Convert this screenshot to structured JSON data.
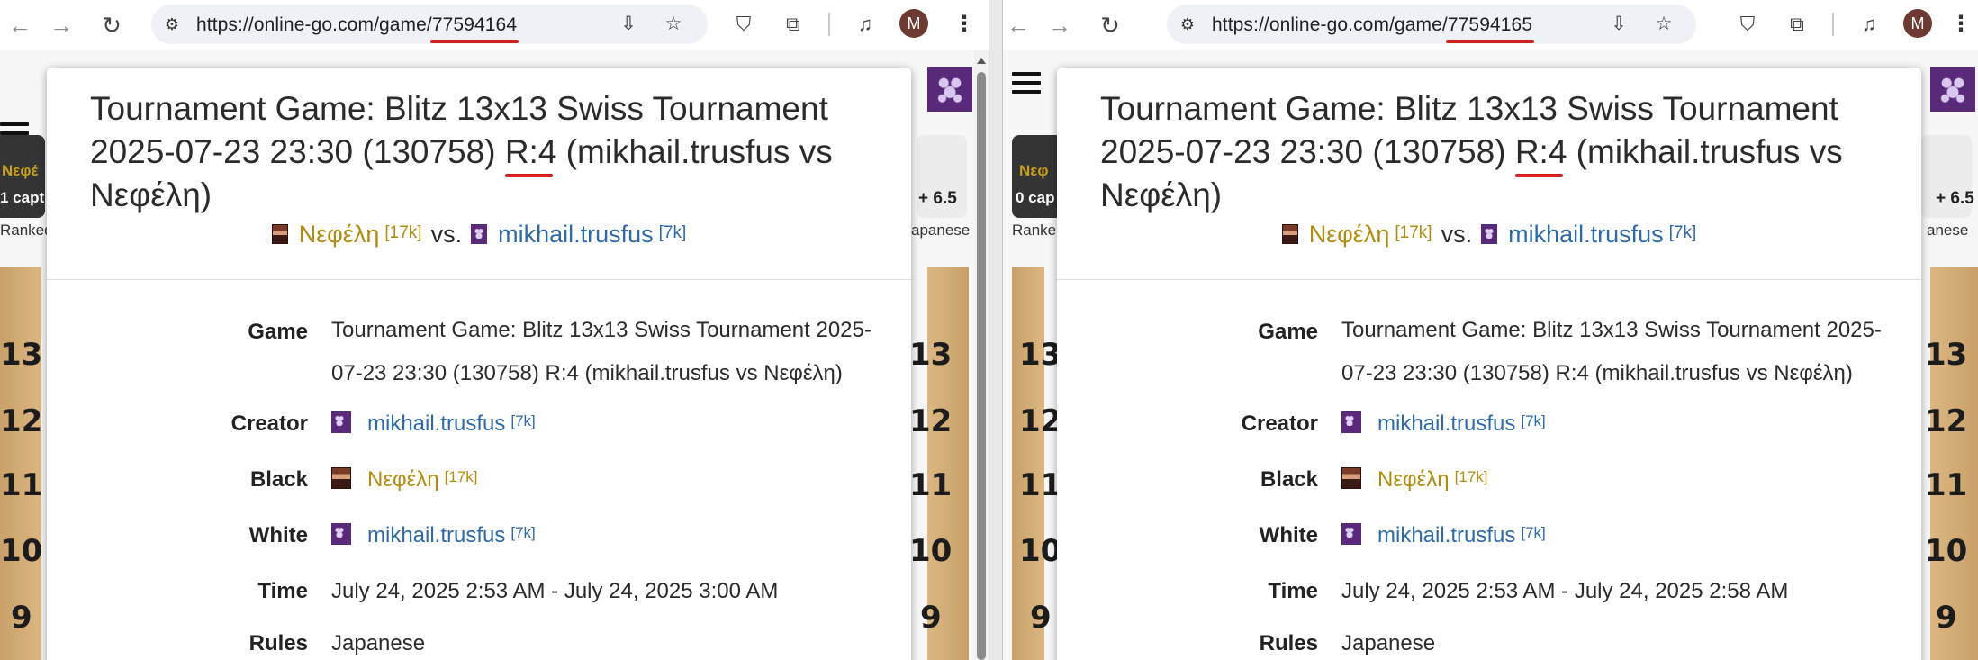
{
  "left": {
    "url_prefix": "https://",
    "url_host": "online-go.com",
    "url_path": "/game/",
    "url_id": "77594164",
    "side": {
      "name_fragment": "Νεφέ",
      "captures": "1 capt",
      "ranked": "Ranked",
      "komi": "+ 6.5",
      "rules_fragment": "apanese"
    },
    "coords": [
      "13",
      "12",
      "11",
      "10",
      "9"
    ],
    "dialog": {
      "title_a": "Tournament Game: Blitz 13x13 Swiss Tournament 2025-07-23 23:30 (130758) ",
      "title_r": "R:4",
      "title_b": " (mikhail.trusfus vs Νεφέλη)",
      "black_name": "Νεφέλη",
      "black_rank": "[17k]",
      "vs": "vs.",
      "white_name": "mikhail.trusfus",
      "white_rank": "[7k]",
      "labels": {
        "game": "Game",
        "creator": "Creator",
        "black": "Black",
        "white": "White",
        "time": "Time",
        "rules": "Rules"
      },
      "game_value": "Tournament Game: Blitz 13x13 Swiss Tournament 2025-07-23 23:30 (130758) R:4 (mikhail.trusfus vs Νεφέλη)",
      "creator_name": "mikhail.trusfus",
      "creator_rank": "[7k]",
      "time_value": "July 24, 2025 2:53 AM - July 24, 2025 3:00 AM",
      "rules_value": "Japanese"
    }
  },
  "right": {
    "url_prefix": "https://",
    "url_host": "online-go.com",
    "url_path": "/game/",
    "url_id": "77594165",
    "side": {
      "name_fragment": "Νεφ",
      "captures": "0 cap",
      "ranked": "Ranke",
      "komi": "+ 6.5",
      "rules_fragment": "anese"
    },
    "coords": [
      "13",
      "12",
      "11",
      "10",
      "9"
    ],
    "dialog": {
      "title_a": "Tournament Game: Blitz 13x13 Swiss Tournament 2025-07-23 23:30 (130758) ",
      "title_r": "R:4",
      "title_b": " (mikhail.trusfus vs Νεφέλη)",
      "black_name": "Νεφέλη",
      "black_rank": "[17k]",
      "vs": "vs.",
      "white_name": "mikhail.trusfus",
      "white_rank": "[7k]",
      "labels": {
        "game": "Game",
        "creator": "Creator",
        "black": "Black",
        "white": "White",
        "time": "Time",
        "rules": "Rules"
      },
      "game_value": "Tournament Game: Blitz 13x13 Swiss Tournament 2025-07-23 23:30 (130758) R:4 (mikhail.trusfus vs Νεφέλη)",
      "creator_name": "mikhail.trusfus",
      "creator_rank": "[7k]",
      "time_value": "July 24, 2025 2:53 AM - July 24, 2025 2:58 AM",
      "rules_value": "Japanese"
    }
  },
  "browser": {
    "avatar_letter": "M",
    "icons": [
      "back-icon",
      "forward-icon",
      "reload-icon",
      "site-settings-icon",
      "install-app-icon",
      "bookmark-star-icon",
      "ublock-icon",
      "extensions-icon",
      "media-controls-icon",
      "profile-avatar",
      "menu-kebab-icon"
    ]
  },
  "colors": {
    "black_player": "#b08d12",
    "white_player": "#2f6aa8",
    "annotation": "#d21f1f"
  }
}
